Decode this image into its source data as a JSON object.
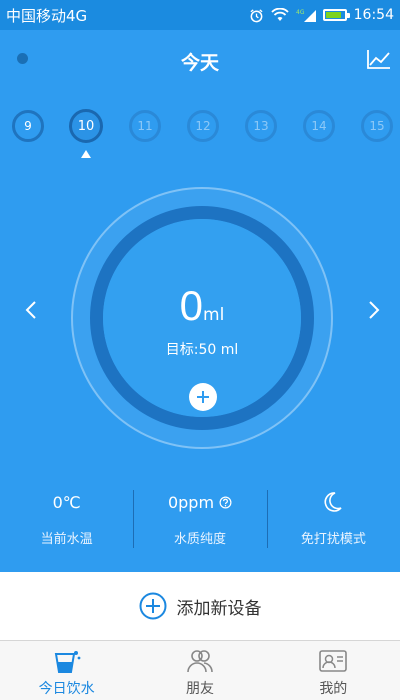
{
  "status": {
    "carrier": "中国移动4G",
    "time": "16:54",
    "network_label": "4G",
    "battery_level": 0.85
  },
  "header": {
    "title": "今天"
  },
  "dates": [
    {
      "label": "9",
      "state": "past"
    },
    {
      "label": "10",
      "state": "selected"
    },
    {
      "label": "11",
      "state": "future"
    },
    {
      "label": "12",
      "state": "future"
    },
    {
      "label": "13",
      "state": "future"
    },
    {
      "label": "14",
      "state": "future"
    },
    {
      "label": "15",
      "state": "future"
    }
  ],
  "intake": {
    "value": "0",
    "unit": "ml",
    "goal_text": "目标:50 ml"
  },
  "stats": {
    "temperature": {
      "value": "0℃",
      "label": "当前水温"
    },
    "purity": {
      "value": "0ppm",
      "label": "水质纯度"
    },
    "mode": {
      "label": "免打扰模式"
    }
  },
  "add_device": {
    "label": "添加新设备"
  },
  "nav": {
    "items": [
      {
        "label": "今日饮水",
        "active": true
      },
      {
        "label": "朋友",
        "active": false
      },
      {
        "label": "我的",
        "active": false
      }
    ]
  },
  "colors": {
    "accent": "#1b88e0",
    "panel": "#2f9cf0",
    "ring": "#1d73c2"
  }
}
